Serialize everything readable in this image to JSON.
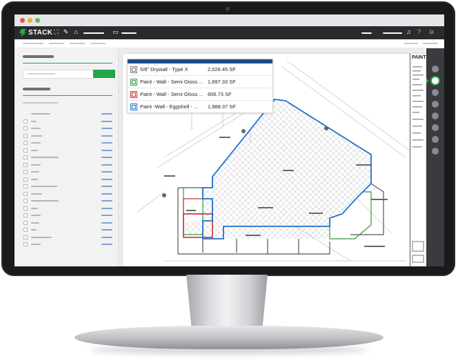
{
  "app": {
    "logo_text": "STACK",
    "brand_color": "#25b04d",
    "toolbar_icons": [
      "fullscreen-icon",
      "edit-icon",
      "home-icon",
      "calendar-icon"
    ],
    "right_icons": [
      "bell-icon",
      "help-icon",
      "user-icon"
    ]
  },
  "sheet": {
    "title": "PAINT"
  },
  "legend": {
    "items": [
      {
        "name": "5/8\" Drywall - Type X",
        "value": "2,026.45 SF",
        "color": "#7a7a7e"
      },
      {
        "name": "Paint - Wall - Semi Gloss ...",
        "value": "1,697.33 SF",
        "color": "#2f9a3c"
      },
      {
        "name": "Paint - Wall - Semi Gloss ...",
        "value": "606.73 SF",
        "color": "#d22b2b"
      },
      {
        "name": "Paint -Wall - Eggshell - ...",
        "value": "1,988.37 SF",
        "color": "#1f6fd1"
      }
    ]
  }
}
